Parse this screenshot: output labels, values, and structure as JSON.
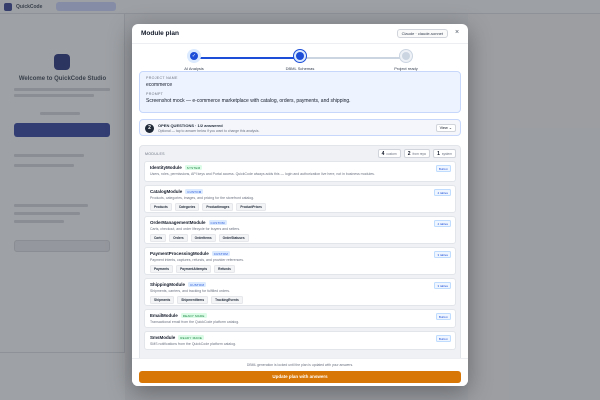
{
  "background": {
    "brand": "QuickCode",
    "welcome": "Welcome to QuickCode Studio"
  },
  "modal": {
    "title": "Module plan",
    "model_chip": "Claude · claude-sonnet",
    "close_glyph": "×"
  },
  "stepper": {
    "steps": [
      {
        "label": "AI Analysis",
        "state": "done",
        "glyph": "✓"
      },
      {
        "label": "DBML Schemas",
        "state": "active",
        "glyph": ""
      },
      {
        "label": "Project ready",
        "state": "pending",
        "glyph": ""
      }
    ],
    "colors": {
      "done": "#1d4ed8",
      "active": "#1d4ed8",
      "pending": "#cbd5e1"
    }
  },
  "project": {
    "name_label": "PROJECT NAME",
    "name": "ecommerce",
    "prompt_label": "PROMPT",
    "prompt": "Screenshot mock — e-commerce marketplace with catalog, orders, payments, and shipping."
  },
  "questions": {
    "number": "2",
    "title": "OPEN QUESTIONS · 1/2 answered",
    "subtitle": "Optional — tap to answer below if you want to change this analysis.",
    "view_label": "View ⌄"
  },
  "modules_section": {
    "label": "MODULES",
    "counts": [
      {
        "n": "4",
        "label": "custom"
      },
      {
        "n": "2",
        "label": "from repo"
      },
      {
        "n": "1",
        "label": "system"
      }
    ],
    "items": [
      {
        "name": "IdentityModule",
        "badge": "SYSTEM",
        "badge_type": "system",
        "right_tag": "Built-in",
        "desc": "Users, roles, permissions, API keys and Portal access. QuickCode always adds this — login and authorization live here, not in business modules.",
        "chips": []
      },
      {
        "name": "CatalogModule",
        "badge": "CUSTOM",
        "badge_type": "custom",
        "right_tag": "4 tables",
        "desc": "Products, categories, images, and pricing for the storefront catalog.",
        "chips": [
          "Products",
          "Categories",
          "ProductImages",
          "ProductPrices"
        ]
      },
      {
        "name": "OrderManagementModule",
        "badge": "CUSTOM",
        "badge_type": "custom",
        "right_tag": "4 tables",
        "desc": "Carts, checkout, and order lifecycle for buyers and sellers.",
        "chips": [
          "Carts",
          "Orders",
          "OrderItems",
          "OrderStatuses"
        ]
      },
      {
        "name": "PaymentProcessingModule",
        "badge": "CUSTOM",
        "badge_type": "custom",
        "right_tag": "3 tables",
        "desc": "Payment intents, captures, refunds, and provider references.",
        "chips": [
          "Payments",
          "PaymentAttempts",
          "Refunds"
        ]
      },
      {
        "name": "ShippingModule",
        "badge": "CUSTOM",
        "badge_type": "custom",
        "right_tag": "3 tables",
        "desc": "Shipments, carriers, and tracking for fulfilled orders.",
        "chips": [
          "Shipments",
          "ShipmentItems",
          "TrackingEvents"
        ]
      },
      {
        "name": "EmailModule",
        "badge": "READY MADE",
        "badge_type": "ready",
        "right_tag": "Built-in",
        "desc": "Transactional email from the QuickCode platform catalog.",
        "chips": []
      },
      {
        "name": "SmsModule",
        "badge": "READY MADE",
        "badge_type": "ready",
        "right_tag": "Built-in",
        "desc": "SMS notifications from the QuickCode platform catalog.",
        "chips": []
      }
    ]
  },
  "footer": {
    "note": "DBML generation is locked until the plan is updated with your answers.",
    "button": "Update plan with answers"
  },
  "colors": {
    "accent": "#1d4ed8",
    "cta": "#d97706"
  }
}
